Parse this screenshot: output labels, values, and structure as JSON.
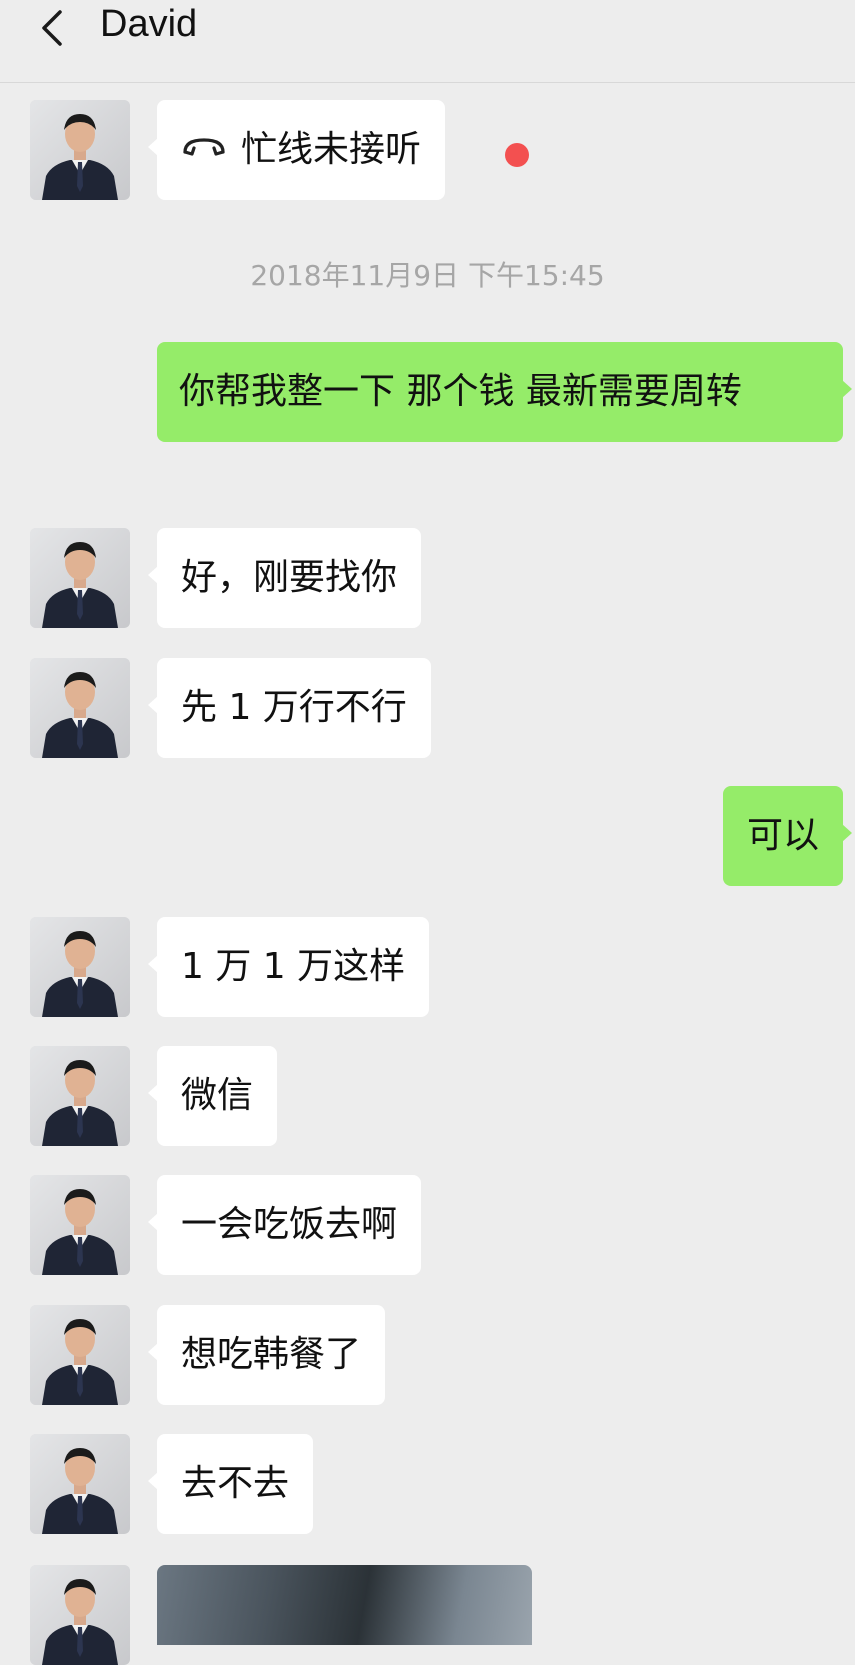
{
  "header": {
    "title": "David",
    "back_icon": "chevron-left-icon"
  },
  "conversation": {
    "timestamp": "2018年11月9日 下午15:45",
    "missed_call": {
      "icon": "call-declined-icon",
      "text": "忙线未接听",
      "unread_dot_color": "#f35050"
    },
    "messages": [
      {
        "from": "me",
        "text": "你帮我整一下 那个钱  最新需要周转"
      },
      {
        "from": "David",
        "text": "好，刚要找你"
      },
      {
        "from": "David",
        "text": "先 1 万行不行"
      },
      {
        "from": "me",
        "text": "可以"
      },
      {
        "from": "David",
        "text": "1 万 1 万这样"
      },
      {
        "from": "David",
        "text": "微信"
      },
      {
        "from": "David",
        "text": "一会吃饭去啊"
      },
      {
        "from": "David",
        "text": "想吃韩餐了"
      },
      {
        "from": "David",
        "text": "去不去"
      }
    ]
  },
  "colors": {
    "background": "#ededed",
    "incoming_bubble": "#ffffff",
    "outgoing_bubble": "#95ec69",
    "timestamp_text": "#a6a6a6"
  }
}
